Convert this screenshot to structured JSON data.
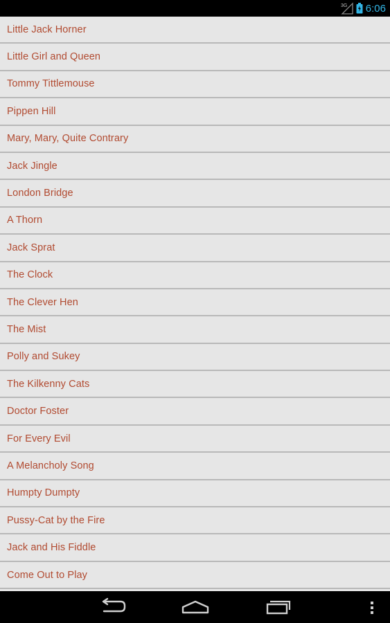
{
  "status_bar": {
    "network": "3G",
    "time": "6:06",
    "accent": "#33b5e5"
  },
  "list": {
    "items": [
      "Little Jack Horner",
      "Little Girl and Queen",
      "Tommy Tittlemouse",
      "Pippen Hill",
      "Mary, Mary, Quite Contrary",
      "Jack Jingle",
      "London Bridge",
      "A Thorn",
      "Jack Sprat",
      "The Clock",
      "The Clever Hen",
      "The Mist",
      "Polly and Sukey",
      "The Kilkenny Cats",
      "Doctor Foster",
      "For Every Evil",
      "A Melancholy Song",
      "Humpty Dumpty",
      "Pussy-Cat by the Fire",
      "Jack and His Fiddle",
      "Come Out to Play"
    ],
    "text_color": "#b14a30"
  },
  "nav_bar": {
    "buttons": [
      "back-icon",
      "home-icon",
      "recent-apps-icon",
      "overflow-menu-icon"
    ]
  }
}
